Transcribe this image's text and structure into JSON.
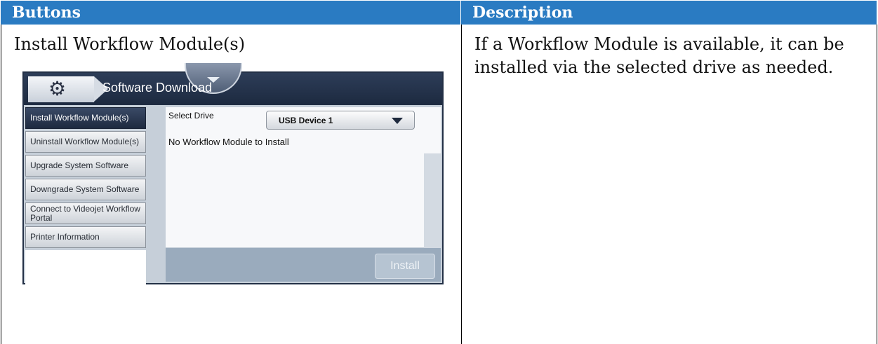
{
  "table": {
    "header_left": "Buttons",
    "header_right": "Description",
    "row": {
      "button_name": "Install Workflow Module(s)",
      "description": "If a Workflow Module is available, it can be installed via the selected drive as needed."
    }
  },
  "screen": {
    "title": "Software Download",
    "icon": "gear-icon",
    "sidebar": {
      "items": [
        {
          "label": "Install Workflow Module(s)",
          "active": true
        },
        {
          "label": "Uninstall Workflow Module(s)"
        },
        {
          "label": "Upgrade System Software"
        },
        {
          "label": "Downgrade System Software"
        },
        {
          "label": "Connect to Videojet Workflow Portal"
        },
        {
          "label": "Printer Information"
        }
      ]
    },
    "select_drive_label": "Select Drive",
    "drive_value": "USB Device 1",
    "status_text": "No Workflow Module to Install",
    "install_label": "Install"
  },
  "colors": {
    "header_blue": "#2a7bc2",
    "title_bar": "#233046",
    "active_item": "#1e2a40"
  }
}
